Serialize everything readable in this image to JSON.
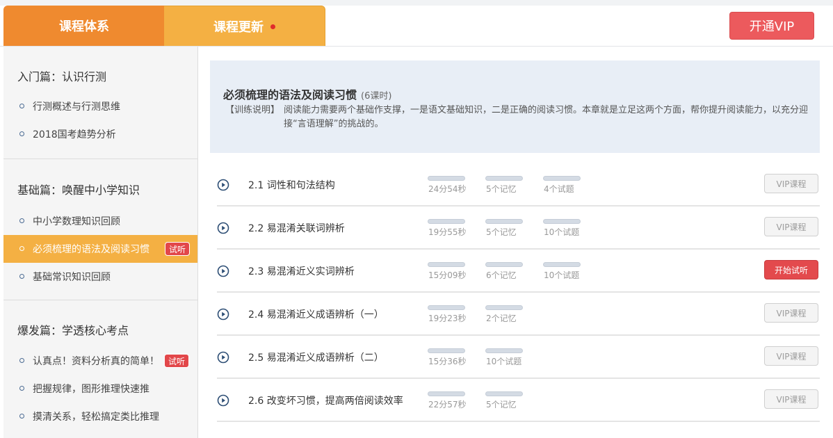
{
  "header": {
    "tab_system": "课程体系",
    "tab_update": "课程更新",
    "vip_button": "开通VIP"
  },
  "sidebar": {
    "sections": [
      {
        "title": "入门篇：认识行测",
        "items": [
          {
            "label": "行测概述与行测思维",
            "badge": ""
          },
          {
            "label": "2018国考趋势分析",
            "badge": ""
          }
        ]
      },
      {
        "title": "基础篇：唤醒中小学知识",
        "items": [
          {
            "label": "中小学数理知识回顾",
            "badge": ""
          },
          {
            "label": "必须梳理的语法及阅读习惯",
            "badge": "试听",
            "active": true
          },
          {
            "label": "基础常识知识回顾",
            "badge": ""
          }
        ]
      },
      {
        "title": "爆发篇：学透核心考点",
        "items": [
          {
            "label": "认真点！资料分析真的简单！",
            "badge": "试听"
          },
          {
            "label": "把握规律，图形推理快速推",
            "badge": ""
          },
          {
            "label": "摸清关系，轻松搞定类比推理",
            "badge": ""
          }
        ]
      }
    ]
  },
  "intro": {
    "title": "必须梳理的语法及阅读习惯",
    "hours": "(6课时)",
    "desc_label": "【训练说明】",
    "desc_text": "阅读能力需要两个基础作支撑，一是语文基础知识，二是正确的阅读习惯。本章就是立足这两个方面，帮你提升阅读能力，以充分迎接“言语理解”的挑战的。"
  },
  "lessons": [
    {
      "title": "2.1 词性和句法结构",
      "stats": [
        "24分54秒",
        "5个记忆",
        "4个试题"
      ],
      "button": "VIP课程",
      "button_type": "vip"
    },
    {
      "title": "2.2 易混淆关联词辨析",
      "stats": [
        "19分55秒",
        "5个记忆",
        "10个试题"
      ],
      "button": "VIP课程",
      "button_type": "vip"
    },
    {
      "title": "2.3 易混淆近义实词辨析",
      "stats": [
        "15分09秒",
        "6个记忆",
        "10个试题"
      ],
      "button": "开始试听",
      "button_type": "start"
    },
    {
      "title": "2.4 易混淆近义成语辨析（一）",
      "stats": [
        "19分23秒",
        "2个记忆"
      ],
      "button": "VIP课程",
      "button_type": "vip"
    },
    {
      "title": "2.5 易混淆近义成语辨析（二）",
      "stats": [
        "15分36秒",
        "10个试题"
      ],
      "button": "VIP课程",
      "button_type": "vip"
    },
    {
      "title": "2.6 改变坏习惯，提高两倍阅读效率",
      "stats": [
        "22分57秒",
        "5个记忆"
      ],
      "button": "VIP课程",
      "button_type": "vip"
    }
  ]
}
